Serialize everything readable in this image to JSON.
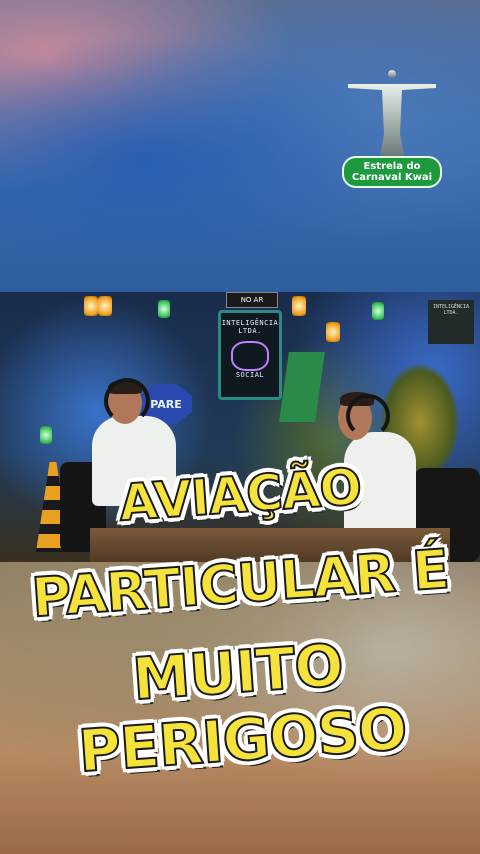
{
  "video": {
    "sign_top": "NO AR",
    "sign_title": "INTELIGÊNCIA LTDA.",
    "sign_sub": "SOCIAL",
    "stop_sign": "PARE",
    "sign_right": "INTELIGÊNCIA LTDA."
  },
  "logo": {
    "line1": "Estrela do",
    "line2": "Carnaval Kwai",
    "icon": "christ-redeemer-icon"
  },
  "caption": {
    "line1": "AVIAÇÃO",
    "line2": "PARTICULAR É",
    "line3": "MUITO PERIGOSO"
  },
  "colors": {
    "caption_fill": "#f5e23a",
    "caption_stroke": "#1a1a1a",
    "badge_green": "#1e9a3e"
  }
}
